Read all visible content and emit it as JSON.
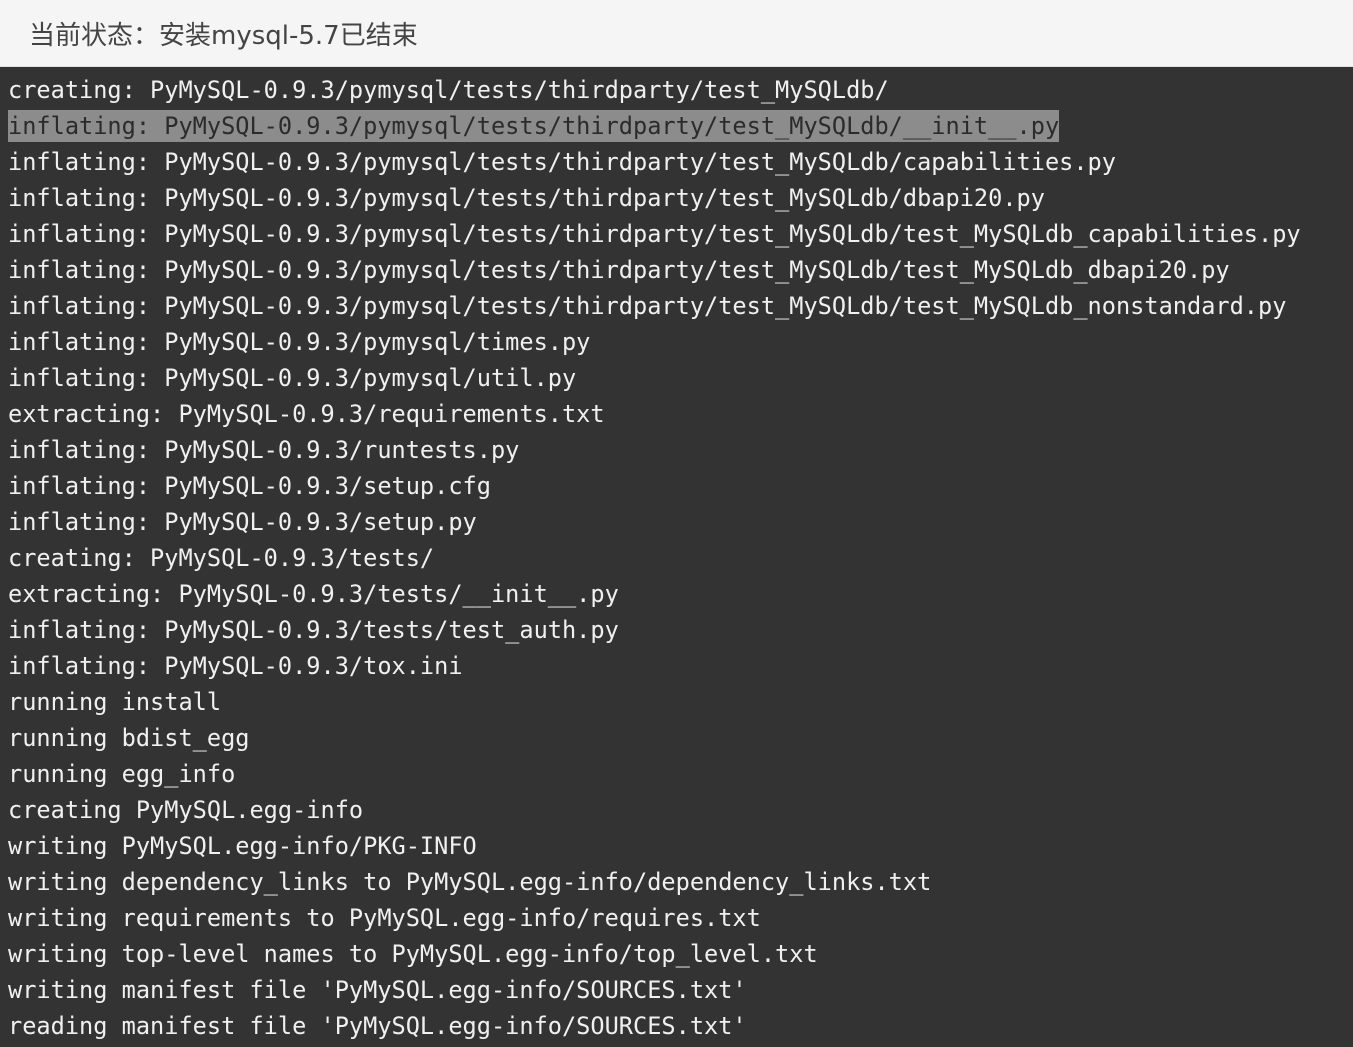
{
  "status": {
    "text": "当前状态：安装mysql-5.7已结束"
  },
  "terminal": {
    "highlight_color": "#8c8c8c",
    "lines": [
      {
        "text": "creating: PyMySQL-0.9.3/pymysql/tests/thirdparty/test_MySQLdb/",
        "highlighted": false
      },
      {
        "text": "inflating: PyMySQL-0.9.3/pymysql/tests/thirdparty/test_MySQLdb/__init__.py",
        "highlighted": true
      },
      {
        "text": "inflating: PyMySQL-0.9.3/pymysql/tests/thirdparty/test_MySQLdb/capabilities.py",
        "highlighted": false
      },
      {
        "text": "inflating: PyMySQL-0.9.3/pymysql/tests/thirdparty/test_MySQLdb/dbapi20.py",
        "highlighted": false
      },
      {
        "text": "inflating: PyMySQL-0.9.3/pymysql/tests/thirdparty/test_MySQLdb/test_MySQLdb_capabilities.py",
        "highlighted": false
      },
      {
        "text": "inflating: PyMySQL-0.9.3/pymysql/tests/thirdparty/test_MySQLdb/test_MySQLdb_dbapi20.py",
        "highlighted": false
      },
      {
        "text": "inflating: PyMySQL-0.9.3/pymysql/tests/thirdparty/test_MySQLdb/test_MySQLdb_nonstandard.py",
        "highlighted": false
      },
      {
        "text": "inflating: PyMySQL-0.9.3/pymysql/times.py",
        "highlighted": false
      },
      {
        "text": "inflating: PyMySQL-0.9.3/pymysql/util.py",
        "highlighted": false
      },
      {
        "text": "extracting: PyMySQL-0.9.3/requirements.txt",
        "highlighted": false
      },
      {
        "text": "inflating: PyMySQL-0.9.3/runtests.py",
        "highlighted": false
      },
      {
        "text": "inflating: PyMySQL-0.9.3/setup.cfg",
        "highlighted": false
      },
      {
        "text": "inflating: PyMySQL-0.9.3/setup.py",
        "highlighted": false
      },
      {
        "text": "creating: PyMySQL-0.9.3/tests/",
        "highlighted": false
      },
      {
        "text": "extracting: PyMySQL-0.9.3/tests/__init__.py",
        "highlighted": false
      },
      {
        "text": "inflating: PyMySQL-0.9.3/tests/test_auth.py",
        "highlighted": false
      },
      {
        "text": "inflating: PyMySQL-0.9.3/tox.ini",
        "highlighted": false
      },
      {
        "text": "running install",
        "highlighted": false
      },
      {
        "text": "running bdist_egg",
        "highlighted": false
      },
      {
        "text": "running egg_info",
        "highlighted": false
      },
      {
        "text": "creating PyMySQL.egg-info",
        "highlighted": false
      },
      {
        "text": "writing PyMySQL.egg-info/PKG-INFO",
        "highlighted": false
      },
      {
        "text": "writing dependency_links to PyMySQL.egg-info/dependency_links.txt",
        "highlighted": false
      },
      {
        "text": "writing requirements to PyMySQL.egg-info/requires.txt",
        "highlighted": false
      },
      {
        "text": "writing top-level names to PyMySQL.egg-info/top_level.txt",
        "highlighted": false
      },
      {
        "text": "writing manifest file 'PyMySQL.egg-info/SOURCES.txt'",
        "highlighted": false
      },
      {
        "text": "reading manifest file 'PyMySQL.egg-info/SOURCES.txt'",
        "highlighted": false
      }
    ]
  }
}
